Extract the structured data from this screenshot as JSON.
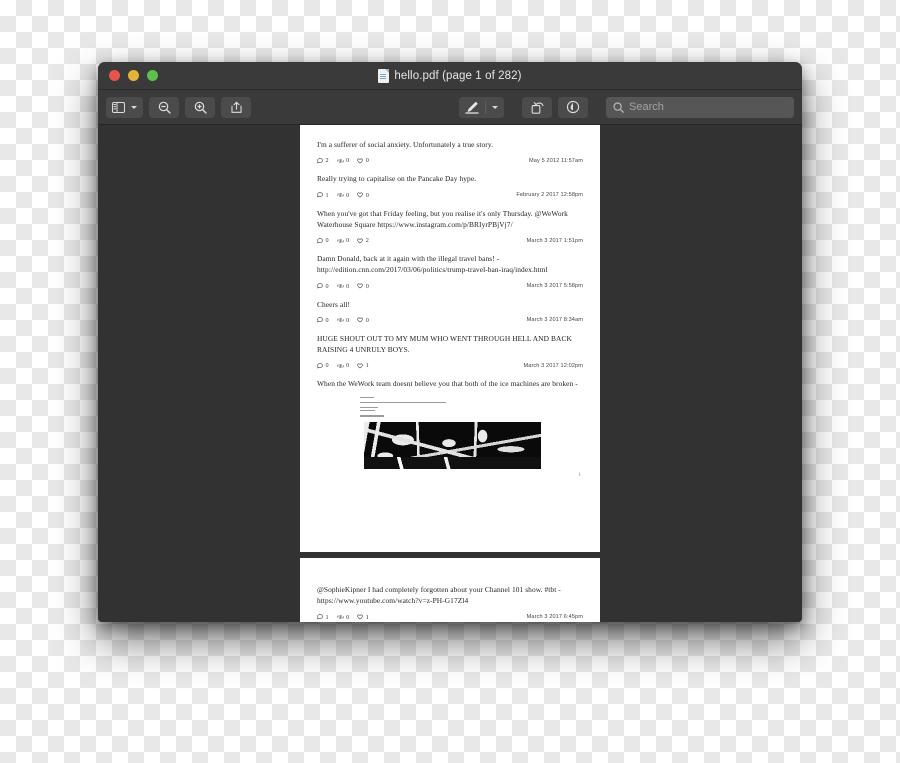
{
  "window": {
    "title": "hello.pdf (page 1 of 282)",
    "traffic_lights": [
      "close",
      "minimize",
      "maximize"
    ],
    "colors": {
      "close": "#e8544a",
      "minimize": "#e5b337",
      "maximize": "#5ec14e",
      "titlebar": "#3a3a3a",
      "viewer_background": "#323232",
      "page": "#ffffff"
    }
  },
  "toolbar": {
    "sidebar_button": "sidebar-toggle",
    "sidebar_chevron": "chevron-down-icon",
    "zoom_out_button": "zoom-out",
    "zoom_in_button": "zoom-in",
    "share_button": "share",
    "markup_button": "markup-pen",
    "markup_chevron": "chevron-down-icon",
    "rotate_button": "rotate-left",
    "highlight_button": "highlight",
    "search": {
      "placeholder": "Search",
      "value": ""
    }
  },
  "document": {
    "page_number_label": "1",
    "pages": [
      {
        "tweets": [
          {
            "text": "I'm a sufferer of social anxiety. Unfortunately a true story.",
            "replies": "2",
            "retweets": "0",
            "likes": "0",
            "timestamp": "May 5 2012 11:57am"
          },
          {
            "text": "Really trying to capitalise on the Pancake Day hype.",
            "replies": "1",
            "retweets": "0",
            "likes": "0",
            "timestamp": "February 2 2017 12:58pm"
          },
          {
            "text": "When you've got that Friday feeling, but you realise it's only Thursday. @WeWork Waterhouse Square https://www.instagram.com/p/BRIyrPBjVj7/",
            "replies": "0",
            "retweets": "0",
            "likes": "2",
            "timestamp": "March 3 2017 1:51pm"
          },
          {
            "text": "Damn Donald, back at it again with the illegal travel bans! - http://edition.cnn.com/2017/03/06/politics/trump-travel-ban-iraq/index.html",
            "replies": "0",
            "retweets": "0",
            "likes": "0",
            "timestamp": "March 3 2017 5:58pm"
          },
          {
            "text": "Cheers all!",
            "replies": "0",
            "retweets": "0",
            "likes": "0",
            "timestamp": "March 3 2017 8:34am"
          },
          {
            "text": "HUGE SHOUT OUT TO MY MUM WHO WENT THROUGH HELL AND BACK RAISING 4 UNRULY BOYS.",
            "replies": "0",
            "retweets": "0",
            "likes": "1",
            "timestamp": "March 3 2017 12:02pm"
          },
          {
            "text": "When the WeWork team doesnt believe you that both of the ice machines are broken -",
            "has_embedded_image": true,
            "embedded_image_name": "email-screenshot-with-photo"
          }
        ]
      },
      {
        "tweets": [
          {
            "text": "@SophieKipner I had completely forgotten about your Channel 101 show. #tbt - https://www.youtube.com/watch?v=z-PH-G17Zl4",
            "replies": "1",
            "retweets": "0",
            "likes": "1",
            "timestamp": "March 3 2017 6:45pm"
          }
        ]
      }
    ]
  },
  "icons": {
    "reply": "reply-bubble-icon",
    "retweet": "retweet-icon",
    "like": "heart-icon"
  }
}
